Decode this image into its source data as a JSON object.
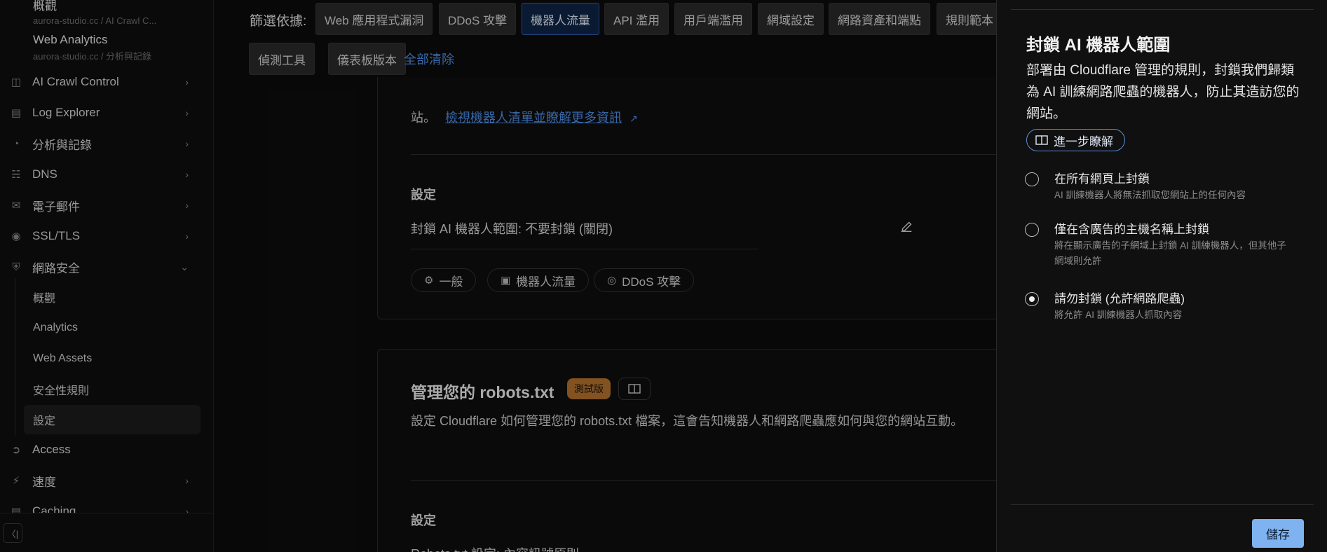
{
  "sidebar": {
    "accounts": [
      {
        "name": "概觀",
        "sub": "aurora-studio.cc / AI Crawl C..."
      },
      {
        "name": "Web Analytics",
        "sub": "aurora-studio.cc / 分析與記錄"
      }
    ],
    "nav": [
      {
        "label": "AI Crawl Control",
        "icon": "crawl-icon",
        "expanded": false
      },
      {
        "label": "Log Explorer",
        "icon": "log-icon",
        "expanded": false
      },
      {
        "label": "分析與記錄",
        "icon": "chart-icon",
        "expanded": false
      },
      {
        "label": "DNS",
        "icon": "dns-icon",
        "expanded": false
      },
      {
        "label": "電子郵件",
        "icon": "mail-icon",
        "expanded": false
      },
      {
        "label": "SSL/TLS",
        "icon": "lock-icon",
        "expanded": false
      },
      {
        "label": "網路安全",
        "icon": "shield-icon",
        "expanded": true
      }
    ],
    "security_sub": [
      "概觀",
      "Analytics",
      "Web Assets",
      "安全性規則",
      "設定"
    ],
    "active_sub": "設定",
    "nav_after": [
      {
        "label": "Access",
        "icon": "access-icon"
      },
      {
        "label": "速度",
        "icon": "bolt-icon"
      },
      {
        "label": "Caching",
        "icon": "cache-icon"
      }
    ]
  },
  "filters": {
    "label": "篩選依據:",
    "chips": [
      "Web 應用程式漏洞",
      "DDoS 攻擊",
      "機器人流量",
      "API 濫用",
      "用戶端濫用",
      "網域設定",
      "網路資產和端點",
      "規則範本",
      "偵測工具",
      "儀表板版本"
    ],
    "selected": "機器人流量",
    "clear_all": "全部清除"
  },
  "card1": {
    "lead": "站。",
    "link": "檢視機器人清單並瞭解更多資訊",
    "settings_heading": "設定",
    "setting_line": "封鎖 AI 機器人範圍: 不要封鎖 (關閉)",
    "tags": [
      "一般",
      "機器人流量",
      "DDoS 攻擊"
    ]
  },
  "card2": {
    "title": "管理您的 robots.txt",
    "badge": "測試版",
    "desc": "設定 Cloudflare 如何管理您的 robots.txt 檔案，這會告知機器人和網路爬蟲應如何與您的網站互動。",
    "settings_heading": "設定",
    "setting_line": "Robots.txt 設定: 內容訊號原則"
  },
  "panel": {
    "title": "封鎖 AI 機器人範圍",
    "desc": "部署由 Cloudflare 管理的規則，封鎖我們歸類為 AI 訓練網路爬蟲的機器人，防止其造訪您的網站。",
    "learn_more": "進一步瞭解",
    "options": [
      {
        "label": "在所有網頁上封鎖",
        "desc": "AI 訓練機器人將無法抓取您網站上的任何內容",
        "selected": false
      },
      {
        "label": "僅在含廣告的主機名稱上封鎖",
        "desc": "將在顯示廣告的子網域上封鎖 AI 訓練機器人，但其他子網域則允許",
        "selected": false
      },
      {
        "label": "請勿封鎖 (允許網路爬蟲)",
        "desc": "將允許 AI 訓練機器人抓取內容",
        "selected": true
      }
    ],
    "save": "儲存"
  },
  "colors": {
    "accent": "#4e8ee6",
    "save_button": "#7fb2f0",
    "beta_badge": "#b4722f",
    "selected_chip": "#0f2546"
  }
}
